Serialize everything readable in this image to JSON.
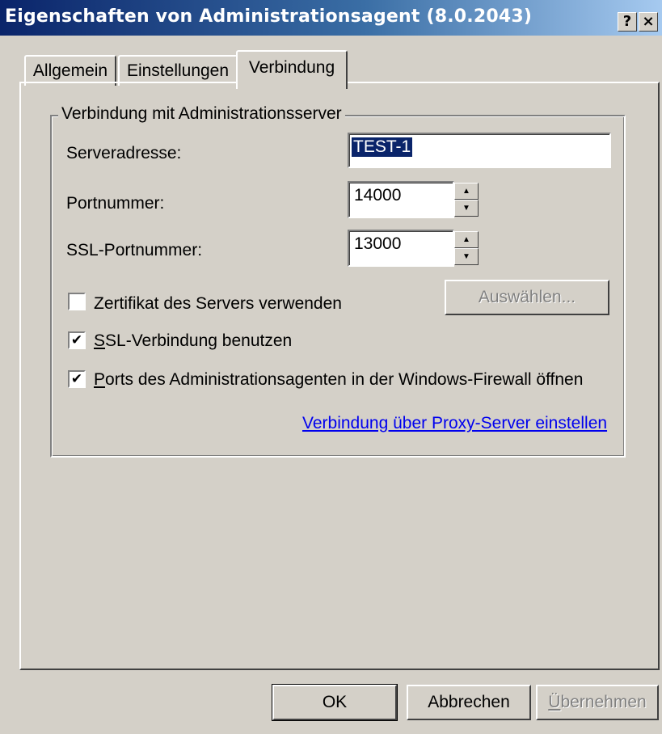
{
  "window": {
    "title": "Eigenschaften von  Administrationsagent (8.0.2043)",
    "help_button": "?",
    "close_button": "×"
  },
  "tabs": [
    {
      "label": "Allgemein",
      "active": false
    },
    {
      "label": "Einstellungen",
      "active": false
    },
    {
      "label": "Verbindung",
      "active": true
    }
  ],
  "group": {
    "title": "Verbindung mit Administrationsserver"
  },
  "fields": {
    "server_address_label": "Serveradresse:",
    "server_address_value": "TEST-1",
    "port_label": "Portnummer:",
    "port_value": "14000",
    "ssl_port_label": "SSL-Portnummer:",
    "ssl_port_value": "13000"
  },
  "checkboxes": [
    {
      "label": "Zertifikat des Servers verwenden",
      "checked": false
    },
    {
      "label_first": "S",
      "label_rest": "SL-Verbindung benutzen",
      "checked": true
    },
    {
      "label_first": "P",
      "label_rest": "orts des Administrationsagenten in der Windows-Firewall öffnen",
      "checked": true
    }
  ],
  "select_button": "Auswählen...",
  "proxy_link": "Verbindung über Proxy-Server einstellen",
  "buttons": {
    "ok": "OK",
    "cancel": "Abbrechen",
    "apply_first": "Ü",
    "apply_rest": "bernehmen"
  },
  "colors": {
    "titlebar_start": "#0a246a",
    "titlebar_end": "#a6caf0",
    "dialog_bg": "#d4d0c8",
    "link": "#0000ee",
    "selection": "#0a246a"
  }
}
